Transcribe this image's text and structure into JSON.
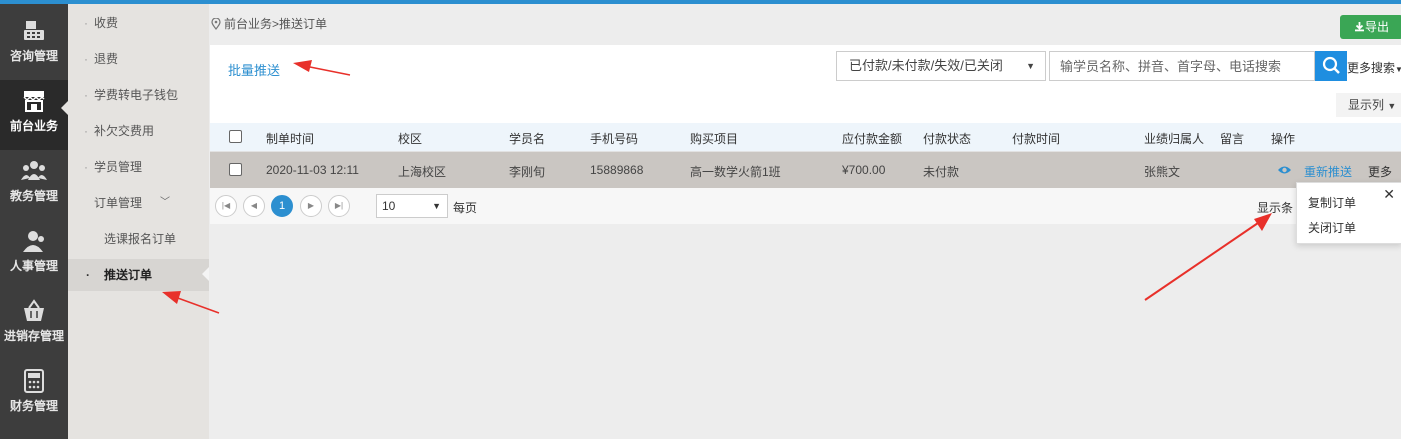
{
  "rail": [
    {
      "label": "咨询管理",
      "icon": "cash-register-icon"
    },
    {
      "label": "前台业务",
      "icon": "storefront-icon",
      "active": true
    },
    {
      "label": "教务管理",
      "icon": "people-group-icon"
    },
    {
      "label": "人事管理",
      "icon": "person-icon"
    },
    {
      "label": "进销存管理",
      "icon": "basket-icon"
    },
    {
      "label": "财务管理",
      "icon": "calculator-icon"
    }
  ],
  "submenu": [
    {
      "label": "收费"
    },
    {
      "label": "退费"
    },
    {
      "label": "学费转电子钱包"
    },
    {
      "label": "补欠交费用"
    },
    {
      "label": "学员管理"
    },
    {
      "label": "订单管理"
    },
    {
      "label": "选课报名订单"
    },
    {
      "label": "推送订单"
    }
  ],
  "breadcrumb": "前台业务>推送订单",
  "toolbar": {
    "export_label": "导出",
    "batch_push": "批量推送",
    "status_filter": "已付款/未付款/失效/已关闭",
    "search_placeholder": "输学员名称、拼音、首字母、电话搜索",
    "more_search": "更多搜索",
    "show_columns": "显示列"
  },
  "table": {
    "headers": [
      "制单时间",
      "校区",
      "学员名",
      "手机号码",
      "购买项目",
      "应付款金额",
      "付款状态",
      "付款时间",
      "业绩归属人",
      "留言",
      "操作"
    ],
    "rows": [
      {
        "time": "2020-11-03 12:11",
        "campus": "上海校区",
        "student": "李刚旬",
        "phone": "15889868",
        "item": "高一数学火箭1班",
        "amount": "¥700.00",
        "status": "未付款",
        "pay_time": "",
        "owner": "张熊文",
        "message": "",
        "op_repush": "重新推送",
        "op_more": "更多"
      }
    ]
  },
  "pager": {
    "current": "1",
    "page_size": "10",
    "per_page": "每页",
    "showing": "显示条"
  },
  "popup": {
    "copy": "复制订单",
    "close": "关闭订单"
  },
  "colors": {
    "accent": "#2c8fd0",
    "export": "#3aa655",
    "annotation": "#e8302a"
  }
}
